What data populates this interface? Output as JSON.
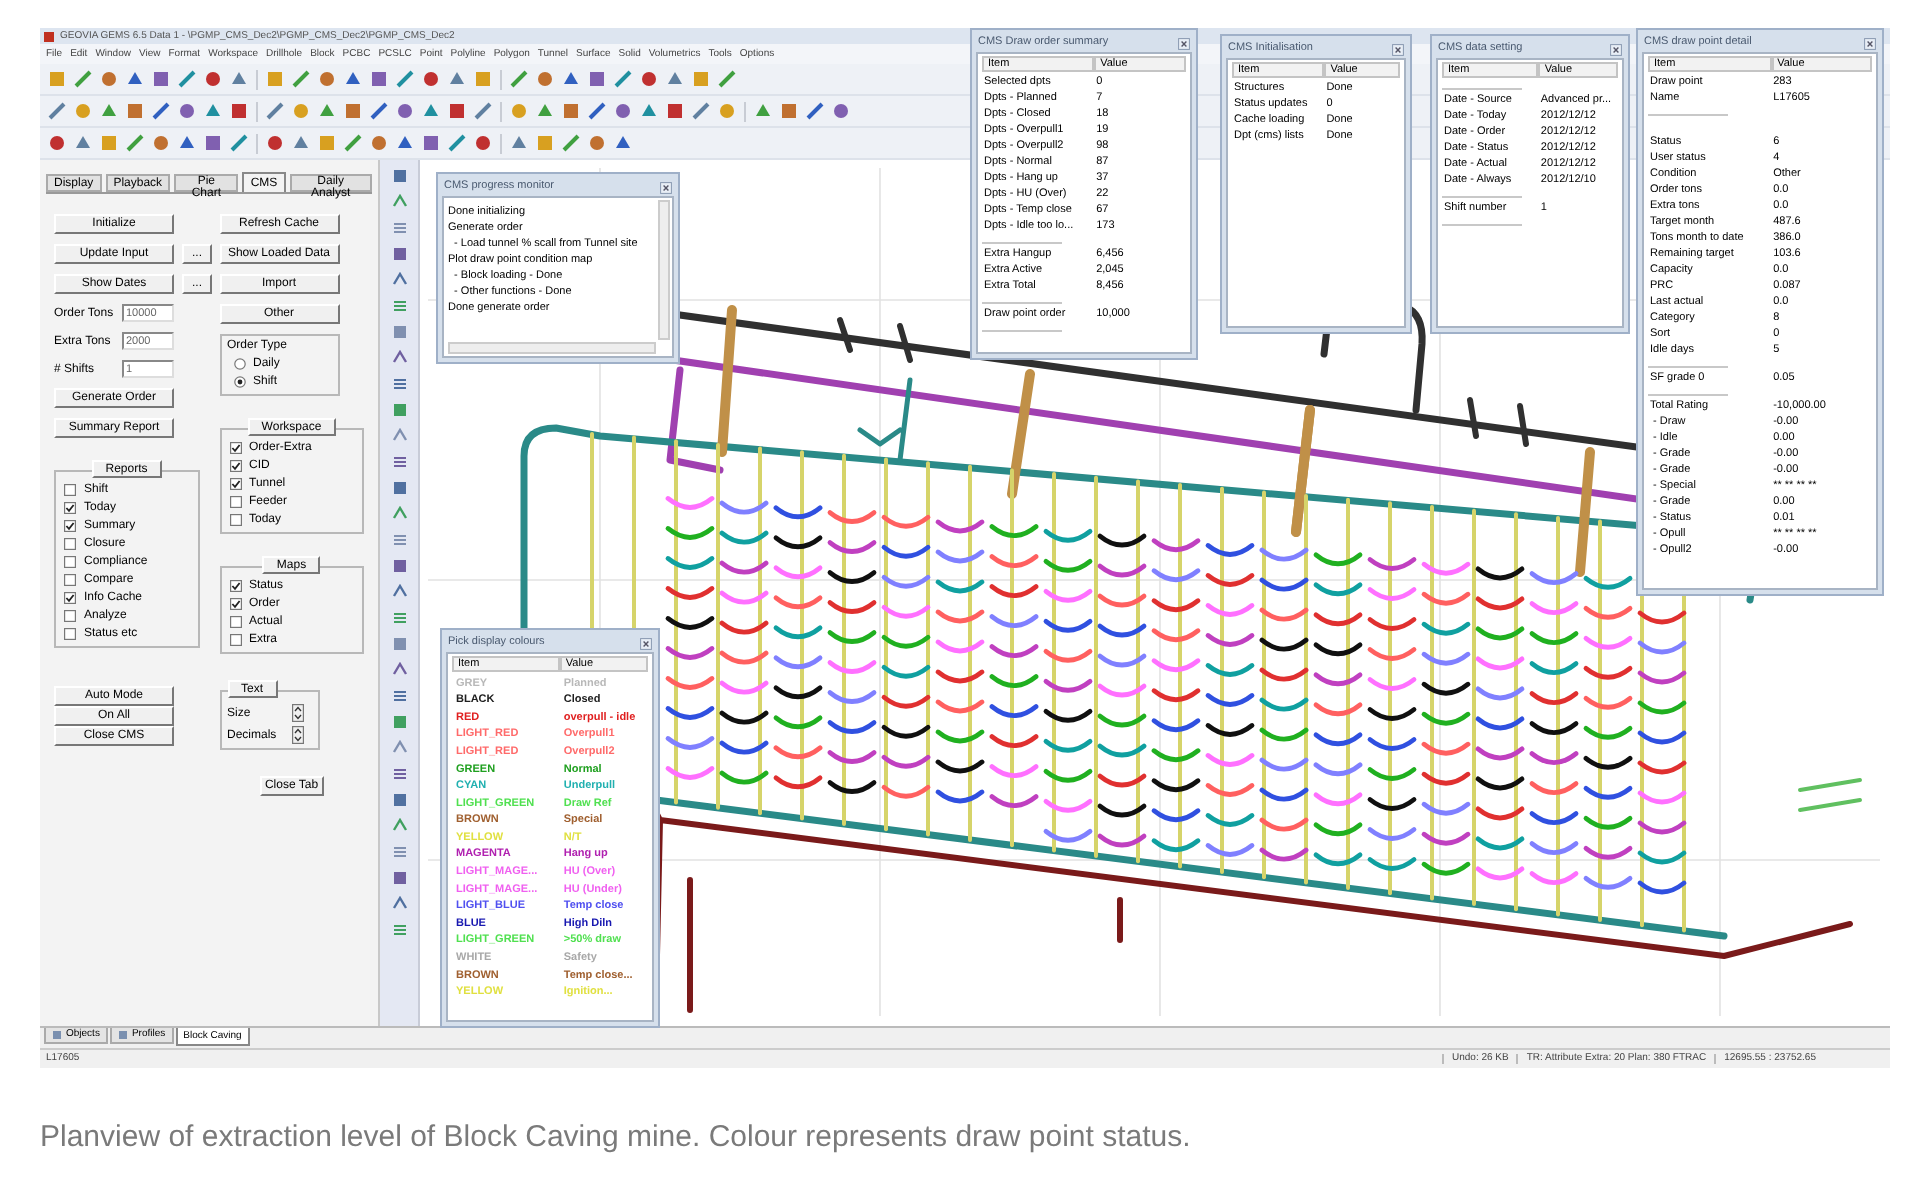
{
  "window": {
    "title": "GEOVIA GEMS 6.5 Data 1 - \\PGMP_CMS_Dec2\\PGMP_CMS_Dec2\\PGMP_CMS_Dec2"
  },
  "menu": [
    "File",
    "Edit",
    "Window",
    "View",
    "Format",
    "Workspace",
    "Drillhole",
    "Block",
    "PCBC",
    "PCSLC",
    "Point",
    "Polyline",
    "Polygon",
    "Tunnel",
    "Surface",
    "Solid",
    "Volumetrics",
    "Tools",
    "Options"
  ],
  "cms_panel": {
    "tabs": [
      {
        "label": "Display",
        "selected": false
      },
      {
        "label": "Playback",
        "selected": false
      },
      {
        "label": "Pie Chart",
        "selected": false
      },
      {
        "label": "CMS",
        "selected": true
      },
      {
        "label": "Daily Analyst",
        "selected": false
      }
    ],
    "initialize": "Initialize",
    "update_input": "Update Input",
    "update_input_more": "...",
    "show_dates": "Show Dates",
    "show_dates_more": "...",
    "refresh_cache": "Refresh Cache",
    "show_loaded_data": "Show Loaded Data",
    "import": "Import",
    "other": "Other",
    "fields": [
      {
        "label": "Order Tons",
        "value": "10000"
      },
      {
        "label": "Extra Tons",
        "value": "2000"
      },
      {
        "label": "# Shifts",
        "value": "1"
      }
    ],
    "order_type": {
      "title": "Order Type",
      "options": [
        {
          "label": "Daily",
          "selected": false
        },
        {
          "label": "Shift",
          "selected": true
        }
      ]
    },
    "generate_order": "Generate Order",
    "summary_report": "Summary Report",
    "reports": {
      "title": "Reports",
      "items": [
        {
          "label": "Shift",
          "checked": false
        },
        {
          "label": "Today",
          "checked": true
        },
        {
          "label": "Summary",
          "checked": true
        },
        {
          "label": "Closure",
          "checked": false
        },
        {
          "label": "Compliance",
          "checked": false
        },
        {
          "label": "Compare",
          "checked": false
        },
        {
          "label": "Info Cache",
          "checked": true
        },
        {
          "label": "Analyze",
          "checked": false
        },
        {
          "label": "Status etc",
          "checked": false
        }
      ]
    },
    "workspace": {
      "title": "Workspace",
      "items": [
        {
          "label": "Order-Extra",
          "checked": true
        },
        {
          "label": "CID",
          "checked": true
        },
        {
          "label": "Tunnel",
          "checked": true
        },
        {
          "label": "Feeder",
          "checked": false
        },
        {
          "label": "Today",
          "checked": false
        }
      ]
    },
    "maps": {
      "title": "Maps",
      "items": [
        {
          "label": "Status",
          "checked": true
        },
        {
          "label": "Order",
          "checked": true
        },
        {
          "label": "Actual",
          "checked": false
        },
        {
          "label": "Extra",
          "checked": false
        }
      ]
    },
    "auto_mode": "Auto Mode",
    "on_all": "On All",
    "close_cms": "Close CMS",
    "text_box": {
      "title": "Text",
      "rows": [
        {
          "label": "Size"
        },
        {
          "label": "Decimals"
        }
      ]
    },
    "close_tab": "Close Tab"
  },
  "windows": [
    {
      "kind": "log",
      "title": "CMS progress monitor",
      "lines": [
        "Done initializing",
        "Generate order",
        "  - Load tunnel % scall from Tunnel site",
        "Plot draw point condition map",
        "  - Block loading - Done",
        "  - Other functions - Done",
        "Done generate order"
      ]
    },
    {
      "kind": "colors",
      "title": "Pick display colours",
      "columns": [
        "Item",
        "Value"
      ],
      "rows": [
        {
          "item": "GREY",
          "value": "Planned",
          "color": "#b8b8b8"
        },
        {
          "item": "BLACK",
          "value": "Closed",
          "color": "#202020"
        },
        {
          "item": "RED",
          "value": "overpull - idle",
          "color": "#e02020"
        },
        {
          "item": "LIGHT_RED",
          "value": "Overpull1",
          "color": "#ff6a6a"
        },
        {
          "item": "LIGHT_RED",
          "value": "Overpull2",
          "color": "#ff6a6a"
        },
        {
          "item": "GREEN",
          "value": "Normal",
          "color": "#20a020"
        },
        {
          "item": "CYAN",
          "value": "Underpull",
          "color": "#20b0b0"
        },
        {
          "item": "LIGHT_GREEN",
          "value": "Draw Ref",
          "color": "#50e050"
        },
        {
          "item": "BROWN",
          "value": "Special",
          "color": "#a06030"
        },
        {
          "item": "YELLOW",
          "value": "N/T",
          "color": "#e0e040"
        },
        {
          "item": "MAGENTA",
          "value": "Hang up",
          "color": "#b020b0"
        },
        {
          "item": "LIGHT_MAGE...",
          "value": "HU (Over)",
          "color": "#f060f0"
        },
        {
          "item": "LIGHT_MAGE...",
          "value": "HU (Under)",
          "color": "#f060f0"
        },
        {
          "item": "LIGHT_BLUE",
          "value": "Temp close",
          "color": "#5050f0"
        },
        {
          "item": "BLUE",
          "value": "High Diln",
          "color": "#1818b0"
        },
        {
          "item": "LIGHT_GREEN",
          "value": ">50% draw",
          "color": "#50e050"
        },
        {
          "item": "WHITE",
          "value": "Safety",
          "color": "#a8a8a8"
        },
        {
          "item": "BROWN",
          "value": "Temp close...",
          "color": "#a06030"
        },
        {
          "item": "YELLOW",
          "value": "Ignition...",
          "color": "#e0e040"
        }
      ]
    },
    {
      "kind": "table",
      "title": "CMS Draw order summary",
      "columns": [
        "Item",
        "Value"
      ],
      "rows": [
        {
          "kind": "row",
          "item": "Selected dpts",
          "value": "0"
        },
        {
          "kind": "row",
          "item": "Dpts - Planned",
          "value": "7"
        },
        {
          "kind": "row",
          "item": "Dpts - Closed",
          "value": "18"
        },
        {
          "kind": "row",
          "item": "Dpts - Overpull1",
          "value": "19"
        },
        {
          "kind": "row",
          "item": "Dpts - Overpull2",
          "value": "98"
        },
        {
          "kind": "row",
          "item": "Dpts - Normal",
          "value": "87"
        },
        {
          "kind": "row",
          "item": "Dpts - Hang up",
          "value": "37"
        },
        {
          "kind": "row",
          "item": "Dpts - HU (Over)",
          "value": "22"
        },
        {
          "kind": "row",
          "item": "Dpts - Temp close",
          "value": "67"
        },
        {
          "kind": "row",
          "item": "Dpts - Idle too lo...",
          "value": "173"
        },
        {
          "kind": "separator"
        },
        {
          "kind": "row",
          "item": "Extra Hangup",
          "value": "6,456"
        },
        {
          "kind": "row",
          "item": "Extra Active",
          "value": "2,045"
        },
        {
          "kind": "row",
          "item": "Extra Total",
          "value": "8,456"
        },
        {
          "kind": "separator"
        },
        {
          "kind": "row",
          "item": "Draw point order",
          "value": "10,000"
        },
        {
          "kind": "separator"
        }
      ]
    },
    {
      "kind": "table",
      "title": "CMS Initialisation",
      "columns": [
        "Item",
        "Value"
      ],
      "rows": [
        {
          "kind": "row",
          "item": "Structures",
          "value": "Done"
        },
        {
          "kind": "row",
          "item": "Status updates",
          "value": "0"
        },
        {
          "kind": "row",
          "item": "Cache loading",
          "value": "Done"
        },
        {
          "kind": "row",
          "item": "Dpt (cms) lists",
          "value": "Done"
        }
      ]
    },
    {
      "kind": "table",
      "title": "CMS data setting",
      "columns": [
        "Item",
        "Value"
      ],
      "rows": [
        {
          "kind": "separator"
        },
        {
          "kind": "row",
          "item": "Date - Source",
          "value": "Advanced pr..."
        },
        {
          "kind": "row",
          "item": "Date - Today",
          "value": "2012/12/12"
        },
        {
          "kind": "row",
          "item": "Date - Order",
          "value": "2012/12/12"
        },
        {
          "kind": "row",
          "item": "Date - Status",
          "value": "2012/12/12"
        },
        {
          "kind": "row",
          "item": "Date - Actual",
          "value": "2012/12/12"
        },
        {
          "kind": "row",
          "item": "Date - Always",
          "value": "2012/12/10"
        },
        {
          "kind": "separator"
        },
        {
          "kind": "row",
          "item": "Shift number",
          "value": "1"
        },
        {
          "kind": "separator"
        }
      ]
    },
    {
      "kind": "table",
      "title": "CMS draw point detail",
      "columns": [
        "Item",
        "Value"
      ],
      "rows": [
        {
          "kind": "row",
          "item": "Draw point",
          "value": "283"
        },
        {
          "kind": "row",
          "item": "Name",
          "value": "L17605"
        },
        {
          "kind": "separator"
        },
        {
          "kind": "gap"
        },
        {
          "kind": "row",
          "item": "Status",
          "value": "6"
        },
        {
          "kind": "row",
          "item": "User status",
          "value": "4"
        },
        {
          "kind": "row",
          "item": "Condition",
          "value": "Other"
        },
        {
          "kind": "row",
          "item": "Order tons",
          "value": "0.0"
        },
        {
          "kind": "row",
          "item": "Extra tons",
          "value": "0.0"
        },
        {
          "kind": "row",
          "item": "Target month",
          "value": "487.6"
        },
        {
          "kind": "row",
          "item": "Tons month to date",
          "value": "386.0"
        },
        {
          "kind": "row",
          "item": "Remaining target",
          "value": "103.6"
        },
        {
          "kind": "row",
          "item": "Capacity",
          "value": "0.0"
        },
        {
          "kind": "row",
          "item": "PRC",
          "value": "0.087"
        },
        {
          "kind": "row",
          "item": "Last actual",
          "value": "0.0"
        },
        {
          "kind": "row",
          "item": "Category",
          "value": "8"
        },
        {
          "kind": "row",
          "item": "Sort",
          "value": "0"
        },
        {
          "kind": "row",
          "item": "Idle days",
          "value": "5"
        },
        {
          "kind": "separator"
        },
        {
          "kind": "row",
          "item": "SF grade 0",
          "value": "0.05"
        },
        {
          "kind": "separator"
        },
        {
          "kind": "row",
          "item": "Total Rating",
          "value": "-10,000.00"
        },
        {
          "kind": "row",
          "item": " - Draw",
          "value": "-0.00"
        },
        {
          "kind": "row",
          "item": " - Idle",
          "value": "0.00"
        },
        {
          "kind": "row",
          "item": " - Grade",
          "value": "-0.00"
        },
        {
          "kind": "row",
          "item": " - Grade",
          "value": "-0.00"
        },
        {
          "kind": "row",
          "item": " - Special",
          "value": "** ** ** **"
        },
        {
          "kind": "row",
          "item": " - Grade",
          "value": "0.00"
        },
        {
          "kind": "row",
          "item": " - Status",
          "value": "0.01"
        },
        {
          "kind": "row",
          "item": " - Opull",
          "value": "** ** ** **"
        },
        {
          "kind": "row",
          "item": " - Opull2",
          "value": "-0.00"
        }
      ]
    }
  ],
  "bottom_tabs": [
    {
      "label": "Objects",
      "selected": false
    },
    {
      "label": "Profiles",
      "selected": false
    },
    {
      "label": "Block Caving",
      "selected": true
    }
  ],
  "status_bar": {
    "left": "L17605",
    "fields": [
      "Undo: 26 KB",
      "TR: Attribute Extra: 20  Plan: 380 FTRAC",
      "12695.55 : 23752.65"
    ]
  },
  "caption": "Planview of extraction level of Block Caving mine. Colour represents draw point status."
}
